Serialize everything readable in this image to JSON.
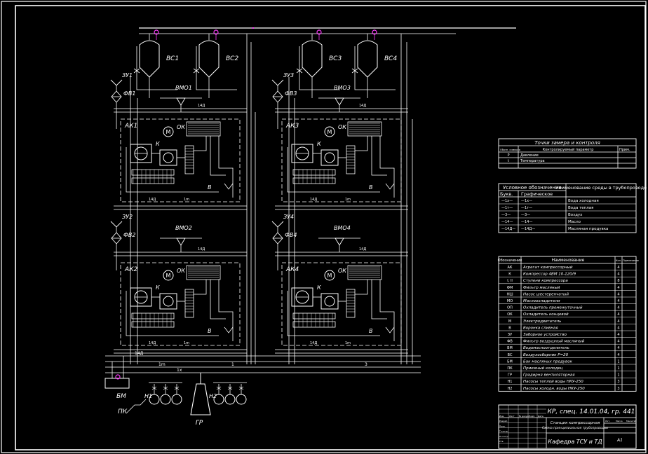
{
  "colors": {
    "background": "#000000",
    "line": "#ffffff",
    "accent": "#ff3cff",
    "frame": "#e6e6e6"
  },
  "diagram": {
    "tanks": [
      "ВС1",
      "ВС2",
      "ВС3",
      "ВС4"
    ],
    "air_filters": [
      "ФВ1",
      "ФВ2",
      "ФВ3",
      "ФВ4"
    ],
    "intakes": [
      "ЗУ1",
      "ЗУ2",
      "ЗУ3",
      "ЗУ4"
    ],
    "water_oil_separators": [
      "ВМО1",
      "ВМО2",
      "ВМО3",
      "ВМО4"
    ],
    "compressor_units": [
      "АК1",
      "АК2",
      "АК3",
      "АК4"
    ],
    "unit_labels": {
      "cooler": "ОК",
      "motor": "М",
      "compressor": "К",
      "stage": "В"
    },
    "line_codes": {
      "water_return": "14Д",
      "stage_1": "1m",
      "cold_water": "1х",
      "main_1": "1",
      "main_3": "3"
    },
    "bottom_labels": {
      "tank": "БМ",
      "cooling_receiver": "ПК",
      "pump_1": "Н1",
      "pump_2": "Н2",
      "cooling_tower": "ГР"
    }
  },
  "points_table": {
    "title": "Точки замера и контроля",
    "headers": [
      "Обозн. символа",
      "Контролируемый параметр",
      "Прим."
    ],
    "rows": [
      [
        "P",
        "Давление",
        ""
      ],
      [
        "t",
        "Температура",
        ""
      ]
    ]
  },
  "media_table": {
    "title_left": "Условное обозначение",
    "title_right": "Наименование среды в трубопроводе",
    "sub_headers": [
      "Букв.",
      "Графическое"
    ],
    "rows": [
      [
        "—1х—",
        "—1х—",
        "Вода холодная"
      ],
      [
        "—1т—",
        "—1т—",
        "Вода теплая"
      ],
      [
        "—3—",
        "—3—",
        "Воздух"
      ],
      [
        "—14—",
        "—14—",
        "Масло"
      ],
      [
        "—14Д—",
        "—14Д—",
        "Масляная продувка"
      ]
    ]
  },
  "legend_table": {
    "headers": [
      "Обозначение",
      "Наименование",
      "Кол.",
      "Примечание"
    ],
    "rows": [
      [
        "АК",
        "Агрегат компрессорный",
        "4",
        ""
      ],
      [
        "К",
        "Компрессор 4ВМ 10-120/9",
        "4",
        ""
      ],
      [
        "I, II",
        "Ступени компрессора",
        "8",
        ""
      ],
      [
        "ФМ",
        "Фильтр масляный",
        "4",
        ""
      ],
      [
        "НШ",
        "Насос шестеренчатый",
        "4",
        ""
      ],
      [
        "МО",
        "Маслоохладители",
        "4",
        ""
      ],
      [
        "ОП",
        "Охладитель промежуточный",
        "4",
        ""
      ],
      [
        "ОК",
        "Охладитель концевой",
        "4",
        ""
      ],
      [
        "М",
        "Электродвигатель",
        "4",
        ""
      ],
      [
        "В",
        "Воронка сливная",
        "4",
        ""
      ],
      [
        "ЗУ",
        "Заборное устройство",
        "4",
        ""
      ],
      [
        "ФВ",
        "Фильтр воздушный масляный",
        "4",
        ""
      ],
      [
        "ВМ",
        "Водомаслоотделитель",
        "4",
        ""
      ],
      [
        "ВС",
        "Воздухосборник Р=20",
        "4",
        ""
      ],
      [
        "БМ",
        "Бак масляных продувок",
        "1",
        ""
      ],
      [
        "ПК",
        "Приемный колодец",
        "1",
        ""
      ],
      [
        "ГР",
        "Градирня вентиляторная",
        "1",
        ""
      ],
      [
        "Н1",
        "Насосы теплой воды НКУ-250",
        "3",
        ""
      ],
      [
        "Н2",
        "Насосы холодн. воды НКУ-250",
        "3",
        ""
      ]
    ]
  },
  "title_block": {
    "code": "КР, спец. 14.01.04, гр. 441",
    "description_line1": "Станция компрессорная",
    "description_line2": "Схема принципиальная трубопроводов",
    "department": "Кафедра ТСУ и ТД",
    "sheet_format": "А1",
    "signature_labels": [
      "Изм.",
      "Лист",
      "№ докум.",
      "Подп.",
      "Дата"
    ],
    "role_labels": [
      "Разраб.",
      "Пров.",
      "Т.контр.",
      "Н.контр.",
      "Утв."
    ],
    "stage_labels": [
      "Лит.",
      "Масса",
      "Масштаб"
    ]
  }
}
